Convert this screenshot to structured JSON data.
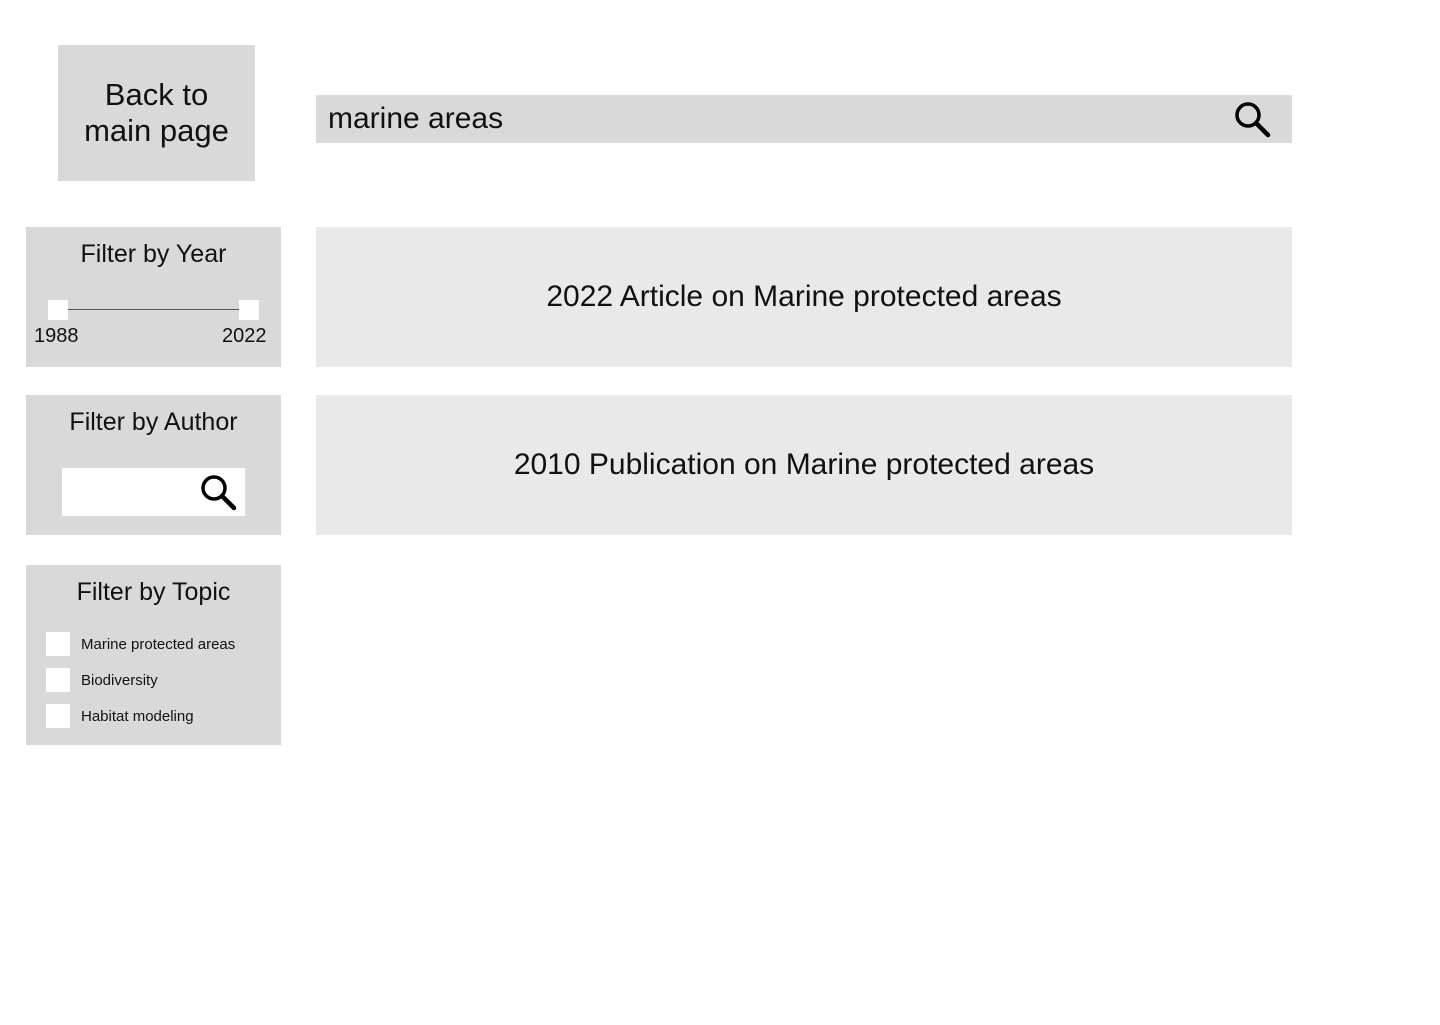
{
  "back_button": {
    "label": "Back to main page"
  },
  "search": {
    "query": "marine areas",
    "icon": "search-icon"
  },
  "filters": {
    "year": {
      "title": "Filter by Year",
      "min_label": "1988",
      "max_label": "2022",
      "range": [
        1988,
        2022
      ]
    },
    "author": {
      "title": "Filter by Author",
      "value": "",
      "icon": "search-icon"
    },
    "topic": {
      "title": "Filter by Topic",
      "options": [
        {
          "label": "Marine protected areas",
          "checked": false
        },
        {
          "label": "Biodiversity",
          "checked": false
        },
        {
          "label": "Habitat modeling",
          "checked": false
        }
      ]
    }
  },
  "results": [
    {
      "title": "2022 Article on Marine protected areas"
    },
    {
      "title": "2010 Publication on Marine protected areas"
    }
  ],
  "colors": {
    "panel": "#d9d9d9",
    "card": "#e9e9e9",
    "background": "#ffffff",
    "text": "#111111"
  }
}
